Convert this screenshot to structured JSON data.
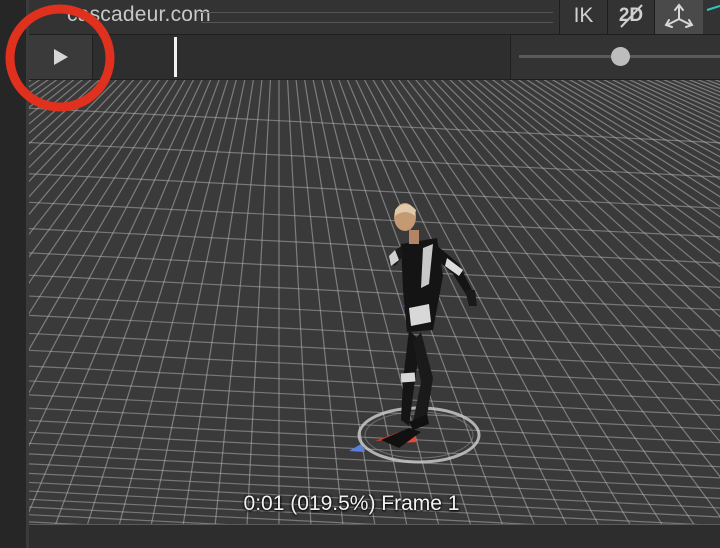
{
  "header": {
    "brand": "cascadeur.com",
    "buttons": {
      "ik_label": "IK",
      "mode_2d_label": "2D",
      "mode_2d_icon": "strikethrough-2d-icon",
      "axes_icon": "transform-axes-icon"
    }
  },
  "toolbar": {
    "play_icon": "play-icon",
    "timeline_position": 0.195,
    "zoom_slider_value": 0.5
  },
  "viewport": {
    "readout": "0:01 (019.5%) Frame 1",
    "grid_color": "#b5b5b5",
    "background_color": "#3a3a3a"
  },
  "annotation": {
    "shape": "circle",
    "color": "#e0301e",
    "target": "play-button"
  }
}
